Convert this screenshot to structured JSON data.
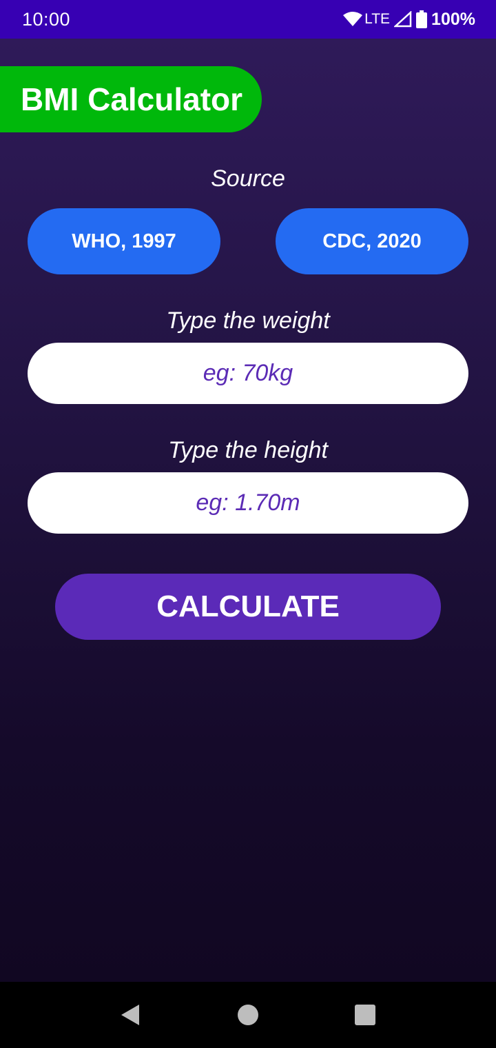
{
  "status": {
    "time": "10:00",
    "network": "LTE",
    "battery": "100%",
    "icons": [
      "wifi-icon",
      "signal-icon",
      "battery-icon"
    ]
  },
  "app": {
    "title": "BMI Calculator",
    "source_label": "Source",
    "sources": [
      "WHO, 1997",
      "CDC, 2020"
    ],
    "weight": {
      "label": "Type the weight",
      "placeholder": "eg: 70kg",
      "value": ""
    },
    "height": {
      "label": "Type the height",
      "placeholder": "eg: 1.70m",
      "value": ""
    },
    "calculate_label": "CALCULATE"
  },
  "navigation": {
    "icons": [
      "back-icon",
      "home-icon",
      "recents-icon"
    ]
  },
  "colors": {
    "status_bar": "#3700b3",
    "title_pill": "#00b80b",
    "source_button": "#246bf2",
    "calculate_button": "#5b2ab8",
    "placeholder_text": "#5b2bb5"
  }
}
